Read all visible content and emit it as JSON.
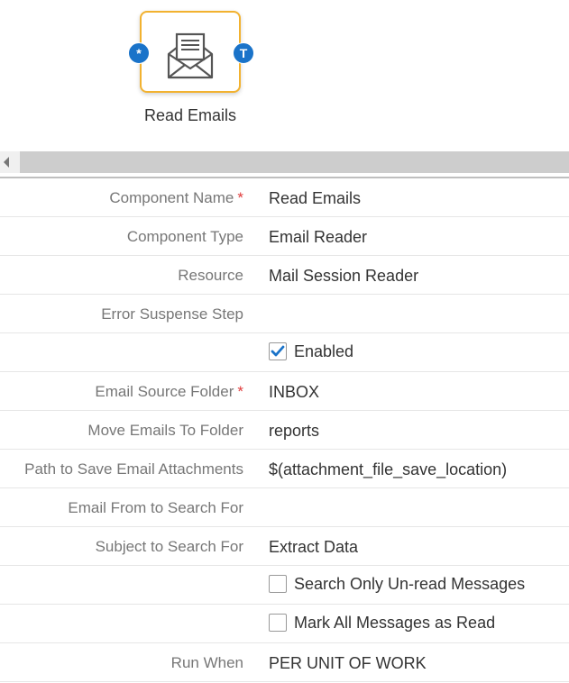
{
  "node": {
    "label": "Read Emails",
    "input_port": "*",
    "output_port": "T",
    "icon": "envelope-open-icon",
    "border_color": "#f2b230",
    "port_color": "#1a73c9"
  },
  "properties": [
    {
      "label": "Component Name",
      "required": "*",
      "value": "Read Emails"
    },
    {
      "label": "Component Type",
      "value": "Email Reader"
    },
    {
      "label": "Resource",
      "value": "Mail Session Reader"
    },
    {
      "label": "Error Suspense Step",
      "value": ""
    },
    {
      "checkbox": "Enabled",
      "checked": true
    },
    {
      "label": "Email Source Folder",
      "required": "*",
      "value": "INBOX"
    },
    {
      "label": "Move Emails To Folder",
      "value": "reports"
    },
    {
      "label": "Path to Save Email Attachments",
      "value": "$(attachment_file_save_location)"
    },
    {
      "label": "Email From to Search For",
      "value": ""
    },
    {
      "label": "Subject to Search For",
      "value": "Extract Data"
    },
    {
      "checkbox": "Search Only Un-read Messages",
      "checked": false
    },
    {
      "checkbox": "Mark All Messages as Read",
      "checked": false
    },
    {
      "label": "Run When",
      "value": "PER UNIT OF WORK"
    }
  ],
  "colors": {
    "required": "#e03a3a",
    "check": "#1a73c9"
  }
}
